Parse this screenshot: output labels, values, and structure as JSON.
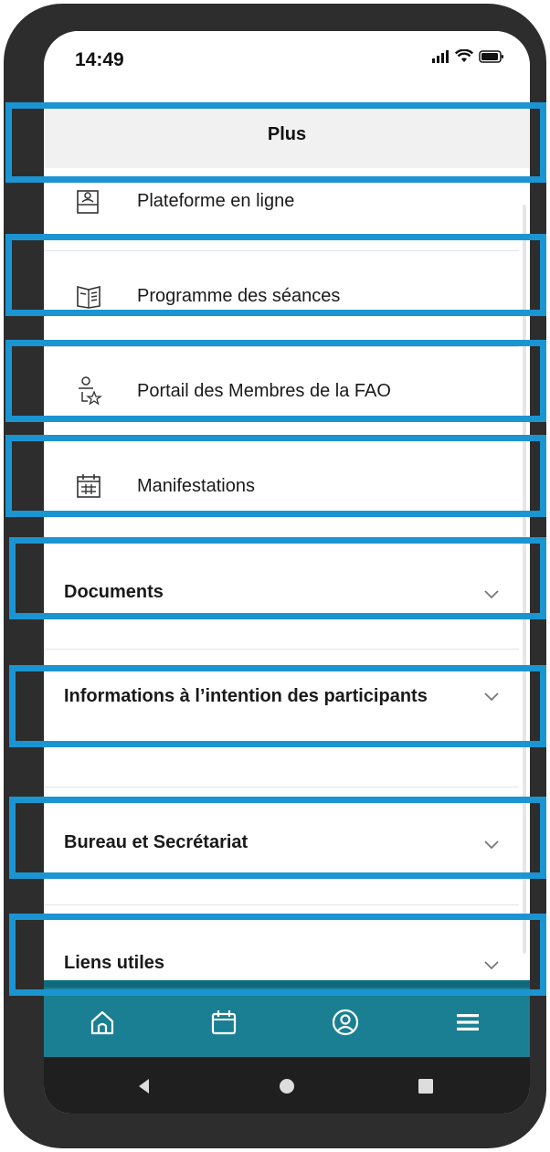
{
  "status_bar": {
    "time": "14:49"
  },
  "header": {
    "title": "Plus"
  },
  "menu_items": [
    {
      "label": "Plateforme en ligne",
      "icon": "user-badge-icon"
    },
    {
      "label": "Programme des séances",
      "icon": "document-list-icon"
    },
    {
      "label": "Portail des Membres de la FAO",
      "icon": "member-star-icon"
    },
    {
      "label": "Manifestations",
      "icon": "calendar-grid-icon"
    }
  ],
  "sections": [
    {
      "label": "Documents",
      "icon": "chevron-down-icon"
    },
    {
      "label": "Informations à l’intention des participants",
      "icon": "chevron-down-icon"
    },
    {
      "label": "Bureau et Secrétariat",
      "icon": "chevron-down-icon"
    },
    {
      "label": "Liens utiles",
      "icon": "chevron-down-icon"
    }
  ],
  "bottom_nav": [
    {
      "name": "home",
      "icon": "home-icon"
    },
    {
      "name": "calendar",
      "icon": "calendar-icon"
    },
    {
      "name": "profile",
      "icon": "profile-icon"
    },
    {
      "name": "menu",
      "icon": "hamburger-menu-icon",
      "active": true
    }
  ],
  "colors": {
    "nav_background": "#1a7f93",
    "highlight_border": "#1b94d2",
    "header_background": "#f1f1f1"
  }
}
